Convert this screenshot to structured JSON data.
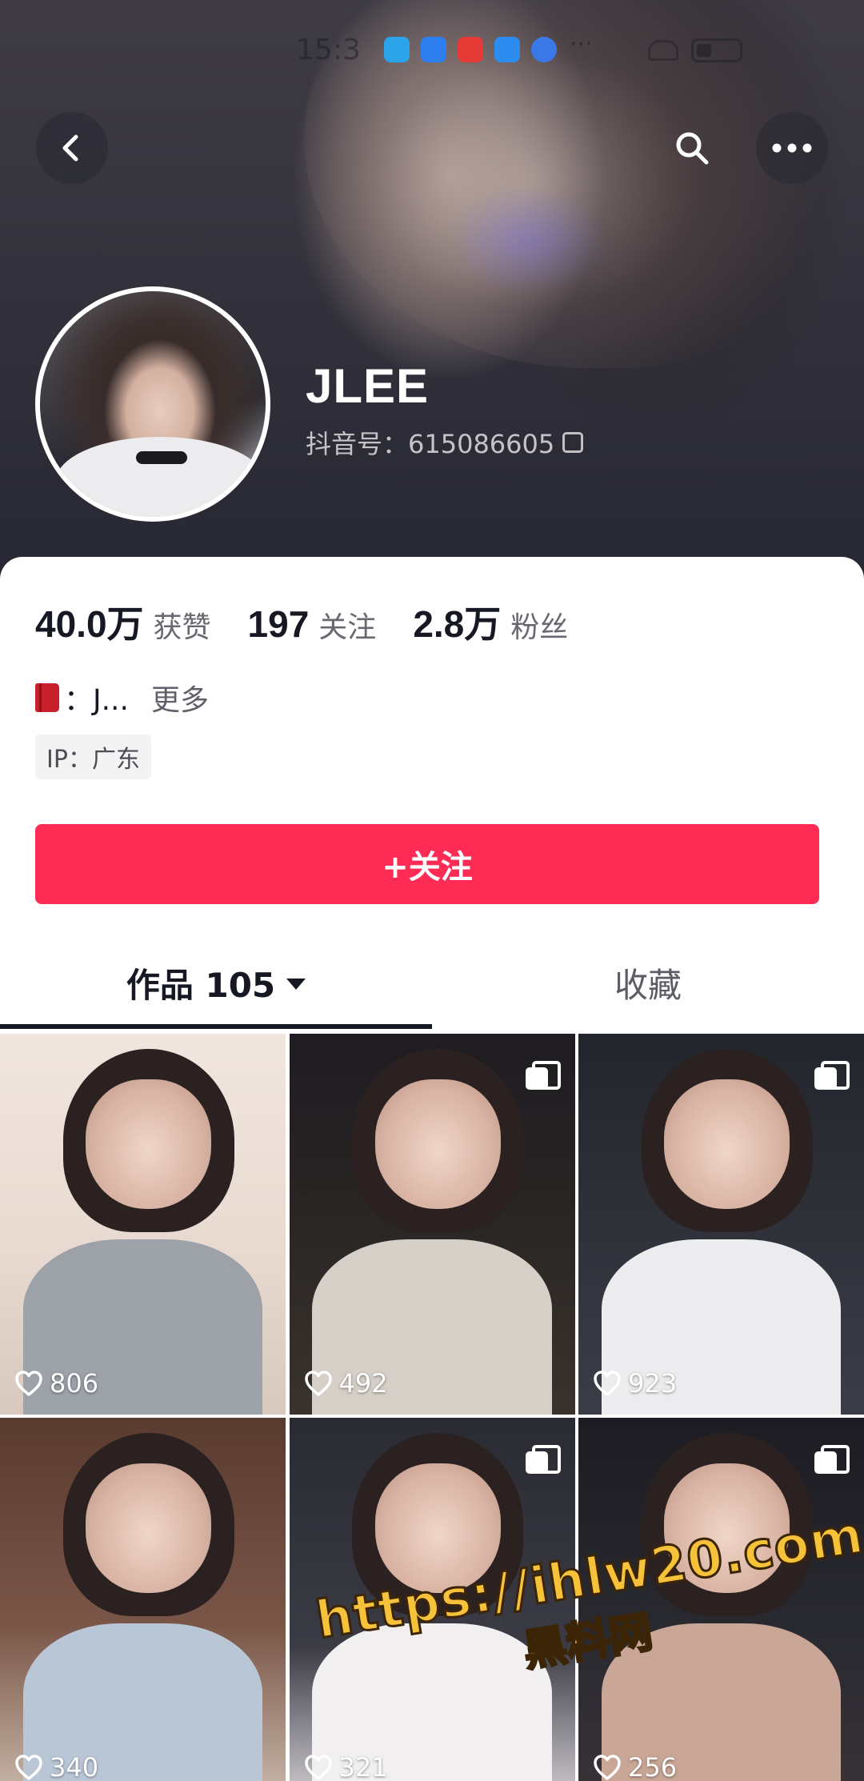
{
  "status_bar": {
    "time": "15:3",
    "more": "···",
    "app_colors": [
      "#2aa3e8",
      "#2d7ff0",
      "#e53b36",
      "#2d8cf0",
      "#3a78e8"
    ]
  },
  "header": {
    "back_icon": "chevron-left-icon",
    "search_icon": "search-icon",
    "more_icon": "more-dots-icon"
  },
  "profile": {
    "nickname": "JLEE",
    "douyin_id": "抖音号：615086605",
    "stats": [
      {
        "value": "40.0万",
        "label": "获赞"
      },
      {
        "value": "197",
        "label": "关注"
      },
      {
        "value": "2.8万",
        "label": "粉丝"
      }
    ],
    "bio": "：J...",
    "bio_more": "更多",
    "ip": "IP：广东",
    "follow_label": "+关注"
  },
  "tabs": {
    "works": "作品 105",
    "favorites": "收藏"
  },
  "grid": [
    {
      "likes": "806",
      "multi": false
    },
    {
      "likes": "492",
      "multi": true
    },
    {
      "likes": "923",
      "multi": true
    },
    {
      "likes": "340",
      "multi": false
    },
    {
      "likes": "321",
      "multi": true
    },
    {
      "likes": "256",
      "multi": true
    }
  ],
  "watermark": {
    "url": "https://ihlw20.com",
    "name": "黑料网"
  },
  "colors": {
    "accent": "#fe2c55",
    "text_primary": "#161823",
    "text_secondary": "#676870",
    "watermark": "#f5c23a"
  }
}
